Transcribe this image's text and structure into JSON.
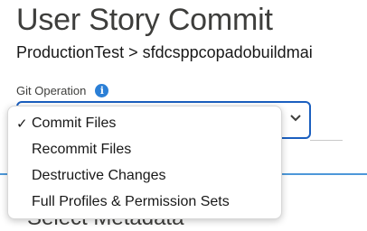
{
  "header": {
    "title": "User Story Commit",
    "breadcrumb": "ProductionTest > sfdcsppcopadobuildmai"
  },
  "git_operation": {
    "label": "Git Operation",
    "info_icon": "info-icon",
    "selected_value": "Commit Files",
    "options": [
      {
        "label": "Commit Files",
        "selected": true
      },
      {
        "label": "Recommit Files",
        "selected": false
      },
      {
        "label": "Destructive Changes",
        "selected": false
      },
      {
        "label": "Full Profiles & Permission Sets",
        "selected": false
      }
    ]
  },
  "section": {
    "heading": "Select Metadata"
  },
  "colors": {
    "accent": "#1b5fbf",
    "info_icon": "#2b7fd6",
    "divider": "#4d98d9"
  }
}
